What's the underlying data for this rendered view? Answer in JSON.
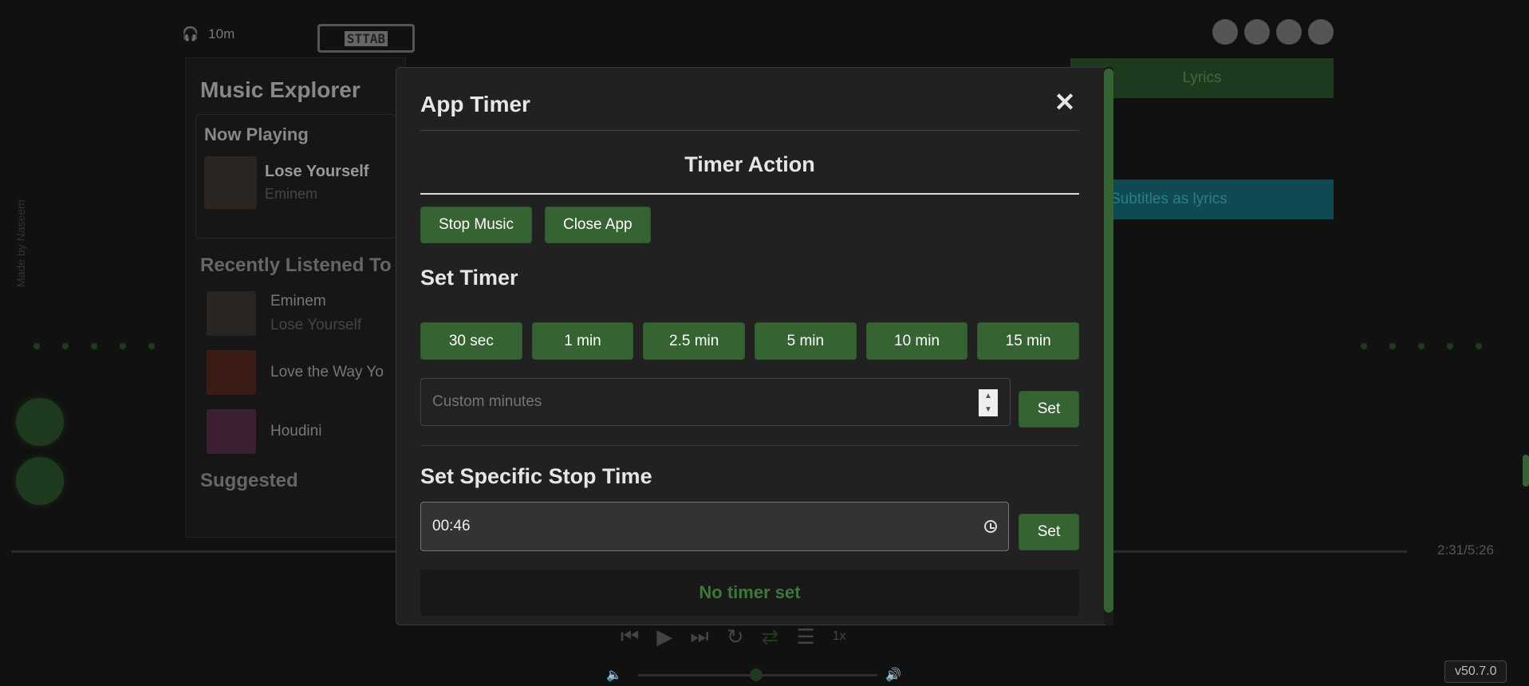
{
  "background": {
    "topbar": {
      "listeners": "10m",
      "logo_chars": "STTAB"
    },
    "explorer": {
      "title": "Music Explorer",
      "now_playing": {
        "heading": "Now Playing",
        "track": "Lose Yourself",
        "artist": "Eminem"
      },
      "recent_heading": "Recently Listened To",
      "recent": [
        {
          "line1": "Eminem",
          "line2": "Lose Yourself"
        },
        {
          "line1": "Love the Way Yo",
          "line2": ""
        },
        {
          "line1": "Houdini",
          "line2": ""
        }
      ],
      "suggested_heading": "Suggested"
    },
    "right_panel": {
      "lyrics_label": "Lyrics",
      "subtitles_label": "Subtitles as lyrics"
    },
    "player": {
      "time": "2:31/5:26"
    },
    "side_text": "Made by Naseem",
    "version": "v50.7.0"
  },
  "modal": {
    "title": "App Timer",
    "close_symbol": "✕",
    "action_title": "Timer Action",
    "actions": [
      "Stop Music",
      "Close App"
    ],
    "set_timer_title": "Set Timer",
    "presets": [
      "30 sec",
      "1 min",
      "2.5 min",
      "5 min",
      "10 min",
      "15 min"
    ],
    "custom_placeholder": "Custom minutes",
    "set_label": "Set",
    "specific_title": "Set Specific Stop Time",
    "specific_time_value": "00:46",
    "status_text": "No timer set"
  },
  "colors": {
    "accent_green": "#356332",
    "status_green": "#3b7a36",
    "modal_bg": "#212121",
    "page_bg": "#111111"
  }
}
